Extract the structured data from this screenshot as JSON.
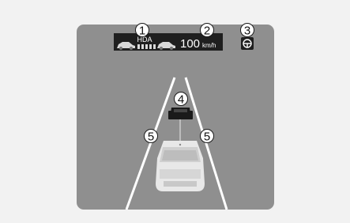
{
  "cluster": {
    "hda_label": "HDA",
    "speed_value": "100",
    "speed_unit": "km/h"
  },
  "callouts": [
    "1",
    "2",
    "3",
    "4",
    "5",
    "5"
  ],
  "colors": {
    "page_background": "#f2f2f2",
    "panel": "#8f8f8f",
    "road": "#8c8c8c",
    "lane_lines": "#ffffff",
    "indicator_box": "#1f1f1f",
    "callout_circle": "#ffffff",
    "callout_text": "#111111"
  },
  "icons": [
    "car-left-icon",
    "following-distance-bars-icon",
    "car-right-icon",
    "steering-wheel-icon",
    "preceding-vehicle-icon",
    "ego-vehicle-icon"
  ]
}
